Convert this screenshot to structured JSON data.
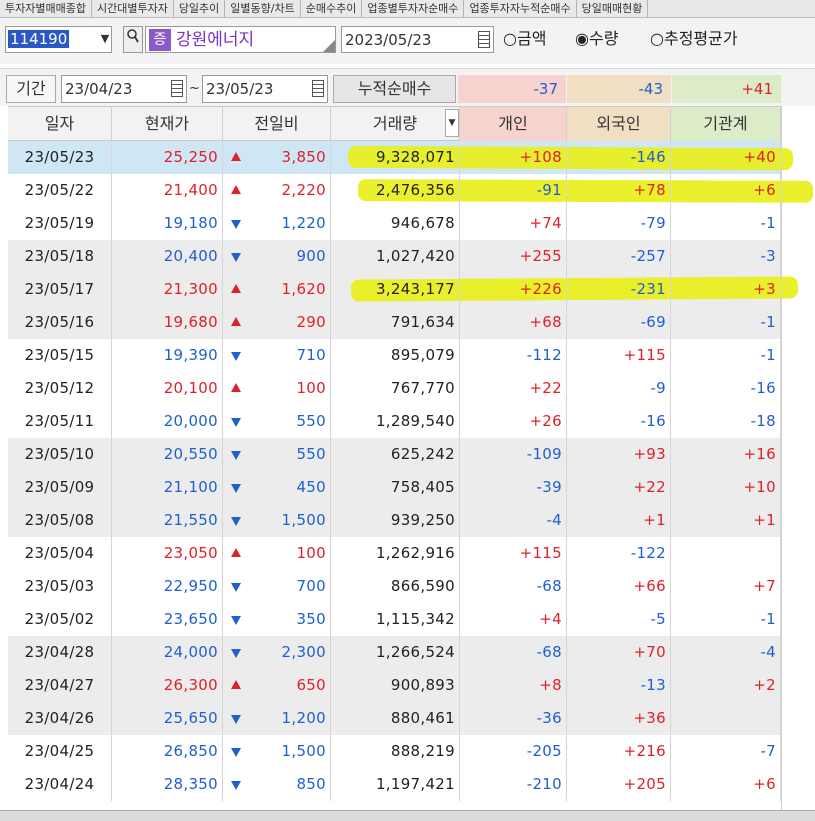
{
  "tabs": [
    "투자자별매매종합",
    "시간대별투자자",
    "당일추이",
    "일별동향/차트",
    "순매수추이",
    "업종별투자자순매수",
    "업종투자자누적순매수",
    "당일매매현황"
  ],
  "search": {
    "code": "114190",
    "search_icon": "magnifier-icon",
    "market_badge": "증",
    "stock_name": "강원에너지",
    "date": "2023/05/23",
    "radio_amount": "금액",
    "radio_qty": "수량",
    "radio_avg": "추정평균가",
    "selected": "수량"
  },
  "period": {
    "label": "기간",
    "from": "23/04/23",
    "to": "23/05/23",
    "tilde": "~",
    "cum_label": "누적순매수",
    "cum_individual": "-37",
    "cum_foreign": "-43",
    "cum_institution": "+41"
  },
  "colors": {
    "up": "#e0202a",
    "down": "#1f5fd0",
    "highlight": "#e9ef1b",
    "selected_row": "#cfe6f5",
    "alt_row": "#ececec"
  },
  "table": {
    "headers": [
      "일자",
      "현재가",
      "전일비",
      "거래량",
      "개인",
      "외국인",
      "기관계"
    ],
    "rows": [
      {
        "date": "23/05/23",
        "price": "25,250",
        "dir": "up",
        "change": "3,850",
        "volume": "9,328,071",
        "ind": "+108",
        "frn": "-146",
        "inst": "+40"
      },
      {
        "date": "23/05/22",
        "price": "21,400",
        "dir": "up",
        "change": "2,220",
        "volume": "2,476,356",
        "ind": "-91",
        "frn": "+78",
        "inst": "+6"
      },
      {
        "date": "23/05/19",
        "price": "19,180",
        "dir": "down",
        "change": "1,220",
        "volume": "946,678",
        "ind": "+74",
        "frn": "-79",
        "inst": "-1"
      },
      {
        "date": "23/05/18",
        "price": "20,400",
        "dir": "down",
        "change": "900",
        "volume": "1,027,420",
        "ind": "+255",
        "frn": "-257",
        "inst": "-3"
      },
      {
        "date": "23/05/17",
        "price": "21,300",
        "dir": "up",
        "change": "1,620",
        "volume": "3,243,177",
        "ind": "+226",
        "frn": "-231",
        "inst": "+3"
      },
      {
        "date": "23/05/16",
        "price": "19,680",
        "dir": "up",
        "change": "290",
        "volume": "791,634",
        "ind": "+68",
        "frn": "-69",
        "inst": "-1"
      },
      {
        "date": "23/05/15",
        "price": "19,390",
        "dir": "down",
        "change": "710",
        "volume": "895,079",
        "ind": "-112",
        "frn": "+115",
        "inst": "-1"
      },
      {
        "date": "23/05/12",
        "price": "20,100",
        "dir": "up",
        "change": "100",
        "volume": "767,770",
        "ind": "+22",
        "frn": "-9",
        "inst": "-16"
      },
      {
        "date": "23/05/11",
        "price": "20,000",
        "dir": "down",
        "change": "550",
        "volume": "1,289,540",
        "ind": "+26",
        "frn": "-16",
        "inst": "-18"
      },
      {
        "date": "23/05/10",
        "price": "20,550",
        "dir": "down",
        "change": "550",
        "volume": "625,242",
        "ind": "-109",
        "frn": "+93",
        "inst": "+16"
      },
      {
        "date": "23/05/09",
        "price": "21,100",
        "dir": "down",
        "change": "450",
        "volume": "758,405",
        "ind": "-39",
        "frn": "+22",
        "inst": "+10"
      },
      {
        "date": "23/05/08",
        "price": "21,550",
        "dir": "down",
        "change": "1,500",
        "volume": "939,250",
        "ind": "-4",
        "frn": "+1",
        "inst": "+1"
      },
      {
        "date": "23/05/04",
        "price": "23,050",
        "dir": "up",
        "change": "100",
        "volume": "1,262,916",
        "ind": "+115",
        "frn": "-122",
        "inst": ""
      },
      {
        "date": "23/05/03",
        "price": "22,950",
        "dir": "down",
        "change": "700",
        "volume": "866,590",
        "ind": "-68",
        "frn": "+66",
        "inst": "+7"
      },
      {
        "date": "23/05/02",
        "price": "23,650",
        "dir": "down",
        "change": "350",
        "volume": "1,115,342",
        "ind": "+4",
        "frn": "-5",
        "inst": "-1"
      },
      {
        "date": "23/04/28",
        "price": "24,000",
        "dir": "down",
        "change": "2,300",
        "volume": "1,266,524",
        "ind": "-68",
        "frn": "+70",
        "inst": "-4"
      },
      {
        "date": "23/04/27",
        "price": "26,300",
        "dir": "up",
        "change": "650",
        "volume": "900,893",
        "ind": "+8",
        "frn": "-13",
        "inst": "+2"
      },
      {
        "date": "23/04/26",
        "price": "25,650",
        "dir": "down",
        "change": "1,200",
        "volume": "880,461",
        "ind": "-36",
        "frn": "+36",
        "inst": ""
      },
      {
        "date": "23/04/25",
        "price": "26,850",
        "dir": "down",
        "change": "1,500",
        "volume": "888,219",
        "ind": "-205",
        "frn": "+216",
        "inst": "-7"
      },
      {
        "date": "23/04/24",
        "price": "28,350",
        "dir": "down",
        "change": "850",
        "volume": "1,197,421",
        "ind": "-210",
        "frn": "+205",
        "inst": "+6"
      }
    ]
  }
}
